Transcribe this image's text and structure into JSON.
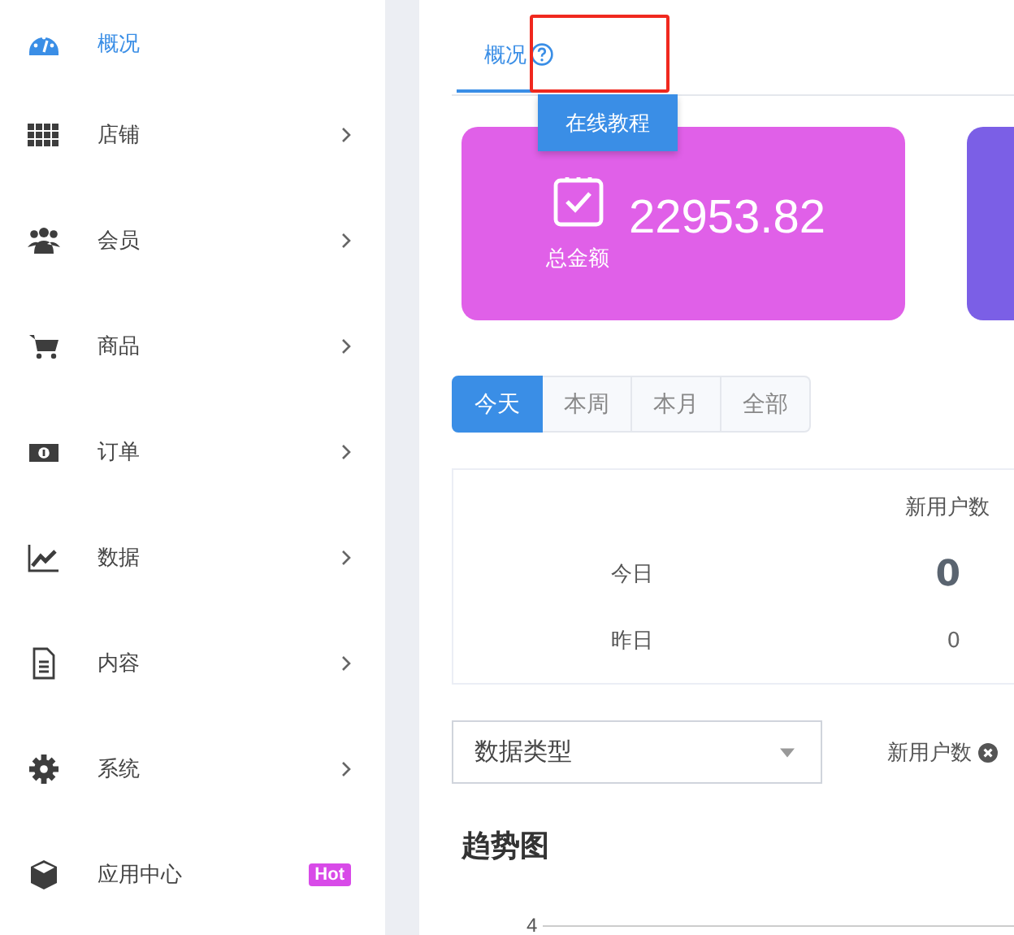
{
  "sidebar": {
    "items": [
      {
        "label": "概况",
        "kind": "gauge",
        "selected": true,
        "expandable": false
      },
      {
        "label": "店铺",
        "kind": "grid",
        "selected": false,
        "expandable": true
      },
      {
        "label": "会员",
        "kind": "users",
        "selected": false,
        "expandable": true
      },
      {
        "label": "商品",
        "kind": "cart",
        "selected": false,
        "expandable": true
      },
      {
        "label": "订单",
        "kind": "money",
        "selected": false,
        "expandable": true
      },
      {
        "label": "数据",
        "kind": "chart",
        "selected": false,
        "expandable": true
      },
      {
        "label": "内容",
        "kind": "doc",
        "selected": false,
        "expandable": true
      },
      {
        "label": "系统",
        "kind": "gear",
        "selected": false,
        "expandable": true
      },
      {
        "label": "应用中心",
        "kind": "cube",
        "selected": false,
        "expandable": false,
        "badge": "Hot"
      }
    ]
  },
  "tabs": [
    {
      "label": "概况",
      "selected": true,
      "help": true
    }
  ],
  "tooltip": "在线教程",
  "cards": [
    {
      "value": "22953.82",
      "label": "总金额",
      "color": "#e060e8"
    },
    {
      "color": "#7b5fe6"
    }
  ],
  "periods": [
    {
      "label": "今天",
      "selected": true
    },
    {
      "label": "本周",
      "selected": false
    },
    {
      "label": "本月",
      "selected": false
    },
    {
      "label": "全部",
      "selected": false
    }
  ],
  "stats": {
    "column_header": "新用户数",
    "rows": [
      {
        "label": "今日",
        "value": "0",
        "emphasis": true
      },
      {
        "label": "昨日",
        "value": "0",
        "emphasis": false
      }
    ]
  },
  "filter": {
    "placeholder": "数据类型",
    "tags": [
      "新用户数"
    ]
  },
  "chart": {
    "title": "趋势图",
    "y_tick_label": "4"
  }
}
